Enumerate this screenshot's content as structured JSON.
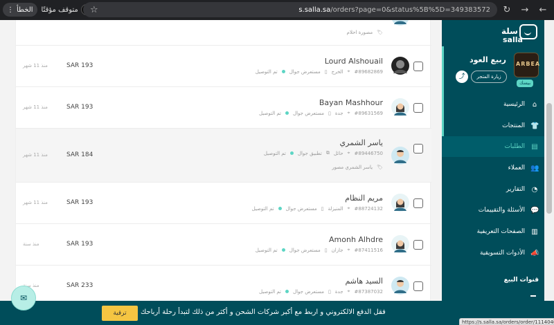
{
  "browser": {
    "url_prefix": "s.salla.sa",
    "url_rest": "/orders?page=0&status%5B%5D=349383572",
    "error_label": "الخطأ",
    "paused_label": "متوقف مؤقتًا",
    "status_url": "https://s.salla.sa/orders/order/1114046713"
  },
  "sidebar": {
    "logo_ar": "سلة",
    "logo_en": "salla",
    "store_name": "ربيع العود",
    "store_logo_text": "ARBEA",
    "plan": "بيسك",
    "visit_store": "زيارة المتجر",
    "nav": [
      {
        "label": "الرئيسية",
        "icon": "⌂",
        "icon_name": "home-icon"
      },
      {
        "label": "المنتجات",
        "icon": "👕",
        "icon_name": "shirt-icon"
      },
      {
        "label": "الطلبات",
        "icon": "▤",
        "icon_name": "orders-icon",
        "active": true
      },
      {
        "label": "العملاء",
        "icon": "👥",
        "icon_name": "users-icon"
      },
      {
        "label": "التقارير",
        "icon": "◔",
        "icon_name": "reports-icon"
      },
      {
        "label": "الأسئلة والتقييمات",
        "icon": "💬",
        "icon_name": "reviews-icon"
      },
      {
        "label": "الصفحات التعريفية",
        "icon": "▥",
        "icon_name": "pages-icon"
      },
      {
        "label": "الأدوات التسويقية",
        "icon": "📣",
        "icon_name": "marketing-icon"
      }
    ],
    "sales_channels": "قنوات البيع"
  },
  "orders": [
    {
      "name": "",
      "order_no": "",
      "city": "",
      "source": "",
      "status": "",
      "tag": "مصورة احلام",
      "amount": "",
      "date": ""
    },
    {
      "name": "Lourd Alshouail",
      "order_no": "#89682869",
      "city": "الخرج",
      "source": "مستعرض جوال",
      "status": "تم التوصيل",
      "amount": "SAR 193",
      "date": "منذ 11 شهر"
    },
    {
      "name": "Bayan Mashhour",
      "order_no": "#89631569",
      "city": "جدة",
      "source": "مستعرض جوال",
      "status": "تم التوصيل",
      "amount": "SAR 193",
      "date": "منذ 11 شهر"
    },
    {
      "name": "ياسر الشمري",
      "order_no": "#89446750",
      "city": "حائل",
      "source": "تطبيق جوال",
      "status": "تم التوصيل",
      "tag": "ياسر الشمري مصور",
      "amount": "SAR 184",
      "date": "منذ 11 شهر"
    },
    {
      "name": "مريم النظام",
      "order_no": "#88724132",
      "city": "المنيزلة",
      "source": "مستعرض جوال",
      "status": "تم التوصيل",
      "amount": "SAR 193",
      "date": "منذ 11 شهر"
    },
    {
      "name": "Amonh Alhdre",
      "order_no": "#87411516",
      "city": "جازان",
      "source": "مستعرض جوال",
      "status": "تم التوصيل",
      "amount": "SAR 193",
      "date": "منذ سنة"
    },
    {
      "name": "السيد هاشم",
      "order_no": "#87387032",
      "city": "جدة",
      "source": "مستعرض جوال",
      "status": "تم التوصيل",
      "amount": "SAR 233",
      "date": "منذ سنة"
    }
  ],
  "banner": {
    "text": "فقل الدفع الالكتروني و اربط مع أكبر شركات الشحن و أكثر من ذلك لتبدأ رحلة أرباحك",
    "upgrade": "ترقية"
  },
  "colors": {
    "sidebar_bg": "#004d5a",
    "accent": "#5dd5c4",
    "upgrade_btn": "#f5c542"
  }
}
